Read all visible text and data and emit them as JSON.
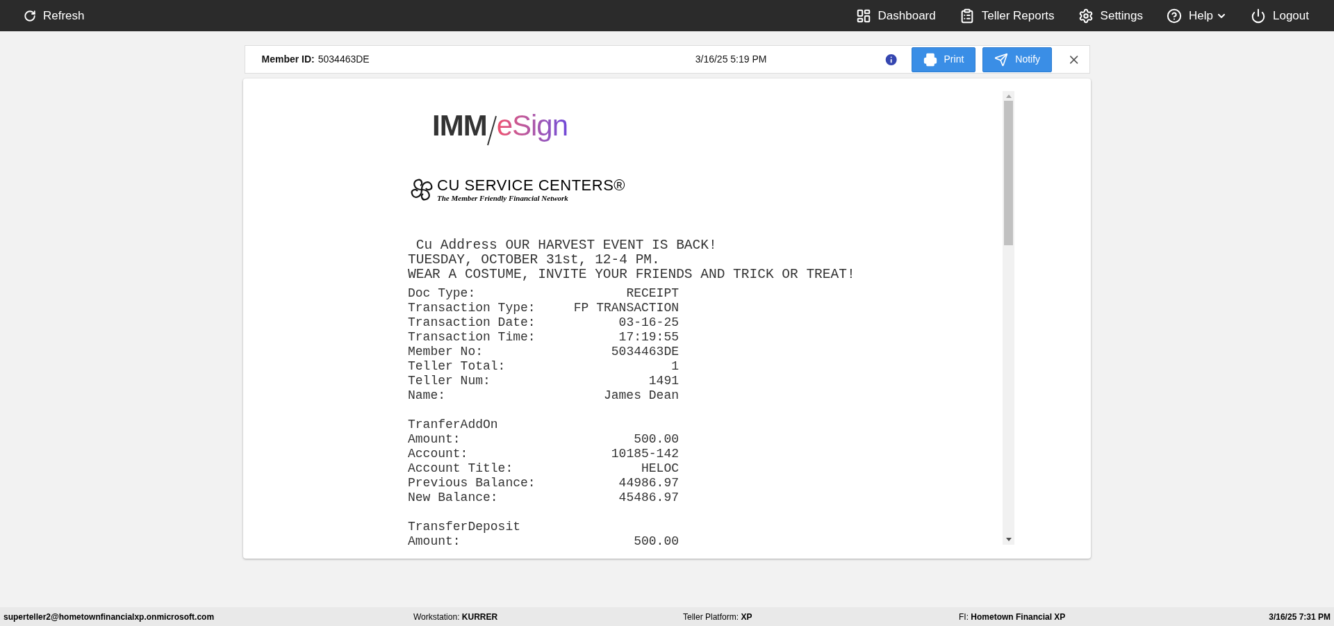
{
  "topbar": {
    "refresh": {
      "label": "Refresh"
    },
    "nav": [
      {
        "kind": "dashboard",
        "label": "Dashboard"
      },
      {
        "kind": "reports",
        "label": "Teller Reports"
      },
      {
        "kind": "settings",
        "label": "Settings"
      },
      {
        "kind": "help",
        "label": "Help",
        "dropdown": true
      },
      {
        "kind": "logout",
        "label": "Logout"
      }
    ]
  },
  "member_bar": {
    "label": "Member ID:",
    "value": "5034463DE",
    "timestamp": "3/16/25 5:19 PM",
    "buttons": [
      {
        "kind": "print",
        "label": "Print"
      },
      {
        "kind": "notify",
        "label": "Notify"
      }
    ]
  },
  "document": {
    "esign_logo": {
      "prefix": "IMM",
      "suffix": "eSign"
    },
    "cu_logo": {
      "name": "CU SERVICE CENTERS®",
      "tagline": "The Member Friendly Financial Network"
    },
    "header_lines": [
      " Cu Address OUR HARVEST EVENT IS BACK!",
      "TUESDAY, OCTOBER 31st, 12-4 PM.",
      "WEAR A COSTUME, INVITE YOUR FRIENDS AND TRICK OR TREAT!"
    ],
    "sections": [
      {
        "rows": [
          {
            "label": "Doc Type:",
            "value": "RECEIPT"
          },
          {
            "label": "Transaction Type:",
            "value": "FP TRANSACTION"
          },
          {
            "label": "Transaction Date:",
            "value": "03-16-25"
          },
          {
            "label": "Transaction Time:",
            "value": "17:19:55"
          },
          {
            "label": "Member No:",
            "value": "5034463DE"
          },
          {
            "label": "Teller Total:",
            "value": "1"
          },
          {
            "label": "Teller Num:",
            "value": "1491"
          },
          {
            "label": "Name:",
            "value": "James Dean"
          }
        ]
      },
      {
        "title": "TranferAddOn",
        "rows": [
          {
            "label": "Amount:",
            "value": "500.00"
          },
          {
            "label": "Account:",
            "value": "10185-142"
          },
          {
            "label": "Account Title:",
            "value": "HELOC"
          },
          {
            "label": "Previous Balance:",
            "value": "44986.97"
          },
          {
            "label": "New Balance:",
            "value": "45486.97"
          }
        ]
      },
      {
        "title": "TransferDeposit",
        "rows": [
          {
            "label": "Amount:",
            "value": "500.00"
          }
        ]
      }
    ]
  },
  "status_bar": {
    "user": "superteller2@hometownfinancialxp.onmicrosoft.com",
    "fields": [
      {
        "label": "Workstation:",
        "value": "KURRER"
      },
      {
        "label": "Teller Platform:",
        "value": "XP"
      },
      {
        "label": "FI:",
        "value": "Hometown Financial XP"
      }
    ],
    "datetime": "3/16/25 7:31 PM"
  }
}
